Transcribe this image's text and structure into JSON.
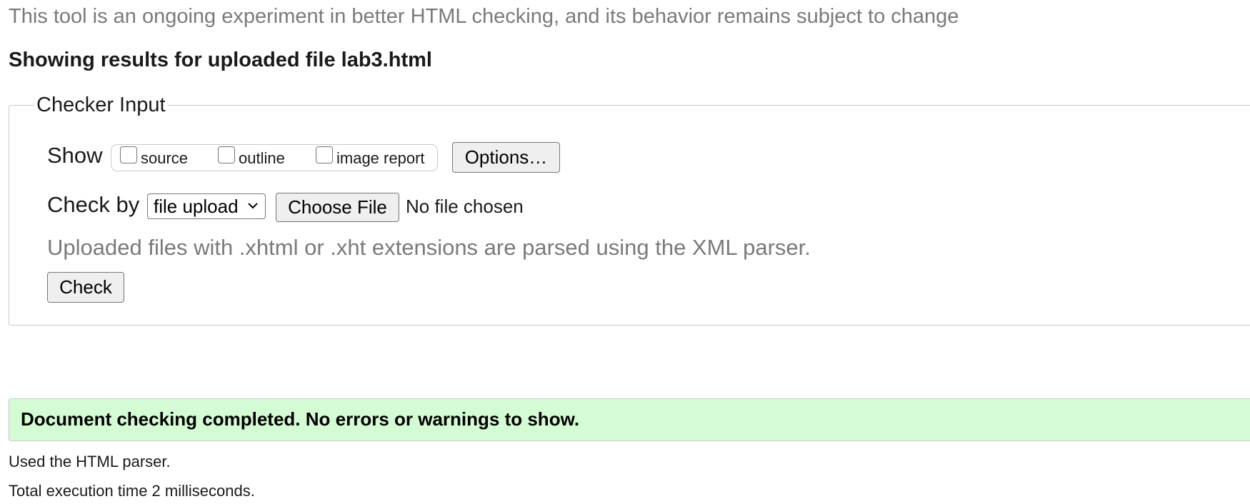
{
  "intro": {
    "experiment_note": "This tool is an ongoing experiment in better HTML checking, and its behavior remains subject to change",
    "results_heading": "Showing results for uploaded file lab3.html"
  },
  "checker_input": {
    "legend": "Checker Input",
    "show_label": "Show",
    "show_options": [
      {
        "label": "source",
        "checked": false
      },
      {
        "label": "outline",
        "checked": false
      },
      {
        "label": "image report",
        "checked": false
      }
    ],
    "options_button": "Options…",
    "check_by_label": "Check by",
    "check_by_selected": "file upload",
    "choose_file_button": "Choose File",
    "file_status": "No file chosen",
    "parser_note": "Uploaded files with .xhtml or .xht extensions are parsed using the XML parser.",
    "check_button": "Check"
  },
  "results": {
    "status_message": "Document checking completed. No errors or warnings to show.",
    "status_color": "#d4fcd4",
    "parser_used": "Used the HTML parser.",
    "execution_time": "Total execution time 2 milliseconds."
  },
  "icons": {
    "select_dropdown": "chevron-down-icon"
  }
}
